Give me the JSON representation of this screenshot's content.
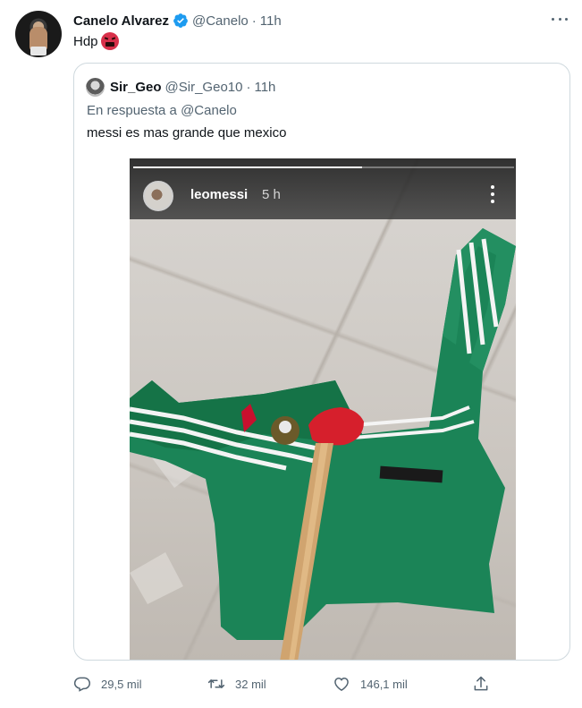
{
  "tweet": {
    "author_name": "Canelo Alvarez",
    "author_handle": "@Canelo",
    "separator": "·",
    "time": "11h",
    "text": "Hdp"
  },
  "quoted": {
    "author_name": "Sir_Geo",
    "author_handle": "@Sir_Geo10",
    "separator": "·",
    "time": "11h",
    "reply_prefix": "En respuesta a",
    "reply_mention": "@Canelo",
    "text": "messi es mas grande que mexico",
    "media": {
      "story_user": "leomessi",
      "story_time": "5 h",
      "progress": 0.6
    }
  },
  "actions": {
    "replies": "29,5 mil",
    "retweets": "32 mil",
    "likes": "146,1 mil"
  },
  "icons": {
    "verified": "verified-badge-icon",
    "more": "more-horizontal-icon",
    "reply": "reply-icon",
    "retweet": "retweet-icon",
    "like": "heart-icon",
    "share": "share-icon",
    "emoji": "enraged-face-emoji"
  },
  "colors": {
    "verified": "#1d9bf0",
    "secondary_text": "#536471",
    "border": "#cfd9de"
  }
}
